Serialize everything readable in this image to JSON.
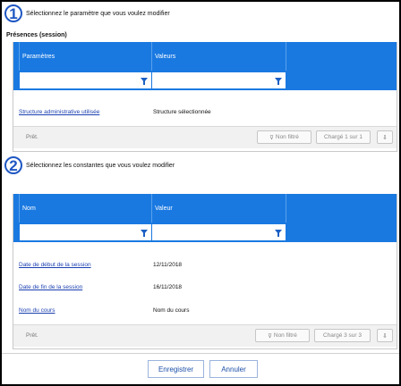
{
  "step1": {
    "number": "1",
    "text": "Sélectionnez le paramètre que vous voulez modifier"
  },
  "section1_title": "Présences (session)",
  "grid1": {
    "headers": [
      "Paramètres",
      "Valeurs"
    ],
    "rows": [
      {
        "param": "Structure administrative utilisée",
        "value": "Structure sélectionnée"
      }
    ],
    "status": "Prêt.",
    "filter_label": "Non filtré",
    "page_label": "Chargé 1 sur 1"
  },
  "step2": {
    "number": "2",
    "text": "Sélectionnez les constantes que vous voulez modifier"
  },
  "grid2": {
    "headers": [
      "Nom",
      "Valeur"
    ],
    "rows": [
      {
        "name": "Date de début de la session",
        "value": "12/11/2018"
      },
      {
        "name": "Date de fin de la session",
        "value": "16/11/2018"
      },
      {
        "name": "Nom du cours",
        "value": "Nom du cours"
      }
    ],
    "status": "Prêt.",
    "filter_label": "Non filtré",
    "page_label": "Chargé 3 sur 3"
  },
  "footer": {
    "save": "Enregistrer",
    "cancel": "Annuler"
  },
  "colors": {
    "header_blue": "#1a79e1",
    "link": "#1a3fb0",
    "step_circle": "#1f57c3"
  }
}
